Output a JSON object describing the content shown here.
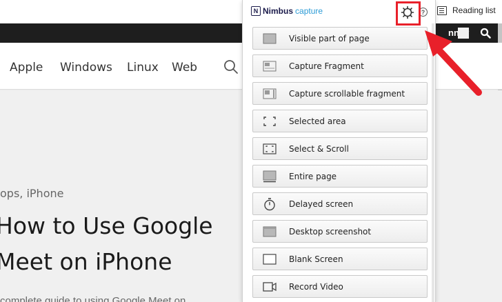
{
  "browser": {
    "reading_list": "Reading list"
  },
  "site": {
    "user_name": "nney",
    "nav": [
      "Apple",
      "Windows",
      "Linux",
      "Web"
    ],
    "category": "ops, iPhone",
    "headline_1": "How to Use Google",
    "headline_2": "Meet on iPhone",
    "excerpt": "complete guide to using Google Meet on"
  },
  "popup": {
    "logo_mark": "N",
    "logo_nimbus": "Nimbus",
    "logo_capture": "capture",
    "help": "?",
    "items": [
      {
        "label": "Visible part of page",
        "icon": "visible-page-icon"
      },
      {
        "label": "Capture Fragment",
        "icon": "capture-fragment-icon"
      },
      {
        "label": "Capture scrollable fragment",
        "icon": "scrollable-fragment-icon"
      },
      {
        "label": "Selected area",
        "icon": "selected-area-icon"
      },
      {
        "label": "Select & Scroll",
        "icon": "select-scroll-icon"
      },
      {
        "label": "Entire page",
        "icon": "entire-page-icon"
      },
      {
        "label": "Delayed screen",
        "icon": "stopwatch-icon"
      },
      {
        "label": "Desktop screenshot",
        "icon": "desktop-icon"
      },
      {
        "label": "Blank Screen",
        "icon": "blank-screen-icon"
      },
      {
        "label": "Record Video",
        "icon": "video-camera-icon"
      }
    ]
  },
  "colors": {
    "highlight": "#e8202a",
    "brand_blue": "#2b9bd6"
  }
}
